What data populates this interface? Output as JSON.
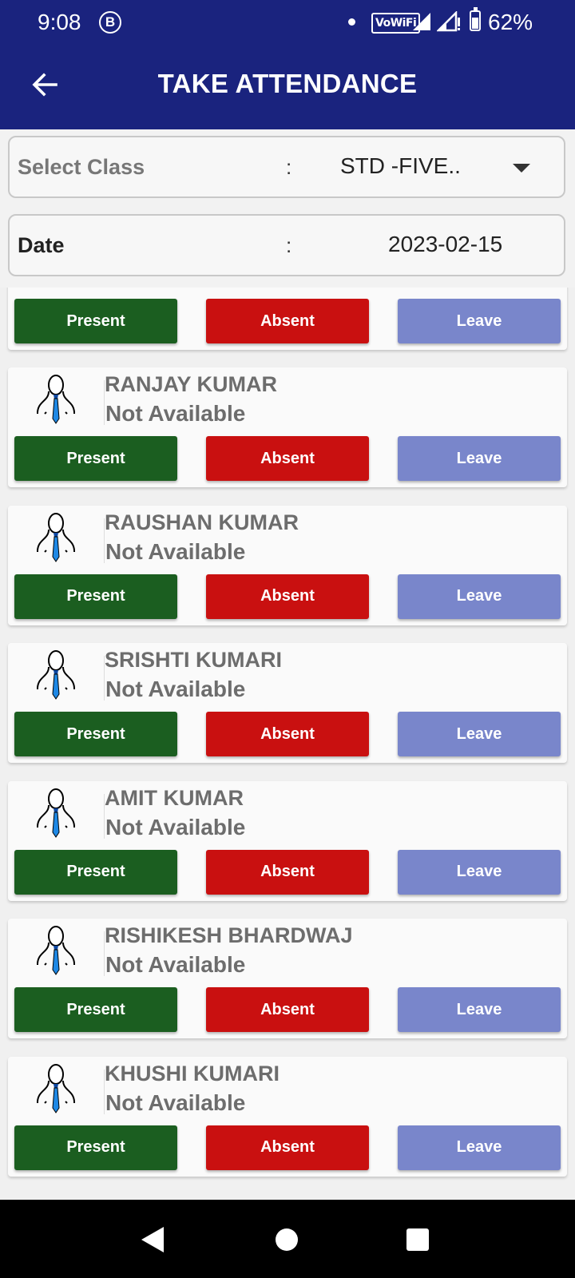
{
  "status_bar": {
    "time": "9:08",
    "b_badge": "B",
    "network": "VoWiFi",
    "battery_pct": "62%",
    "battery_level": 0.62
  },
  "app_bar": {
    "title": "TAKE ATTENDANCE",
    "back_icon": "arrow-back-icon"
  },
  "class_select": {
    "label": "Select Class",
    "separator": ":",
    "value": "STD -FIVE.."
  },
  "date_field": {
    "label": "Date",
    "separator": ":",
    "value": "2023-02-15"
  },
  "buttons": {
    "present": "Present",
    "absent": "Absent",
    "leave": "Leave"
  },
  "colors": {
    "app_bar": "#1a237e",
    "present": "#1b5e20",
    "absent": "#c91010",
    "leave": "#7986cb"
  },
  "students": [
    {
      "name": "RANJAY KUMAR",
      "status": "Not Available"
    },
    {
      "name": "RAUSHAN KUMAR",
      "status": "Not Available"
    },
    {
      "name": "SRISHTI KUMARI",
      "status": "Not Available"
    },
    {
      "name": "AMIT KUMAR",
      "status": "Not Available"
    },
    {
      "name": "RISHIKESH BHARDWAJ",
      "status": "Not Available"
    },
    {
      "name": "KHUSHI KUMARI",
      "status": "Not Available"
    }
  ]
}
